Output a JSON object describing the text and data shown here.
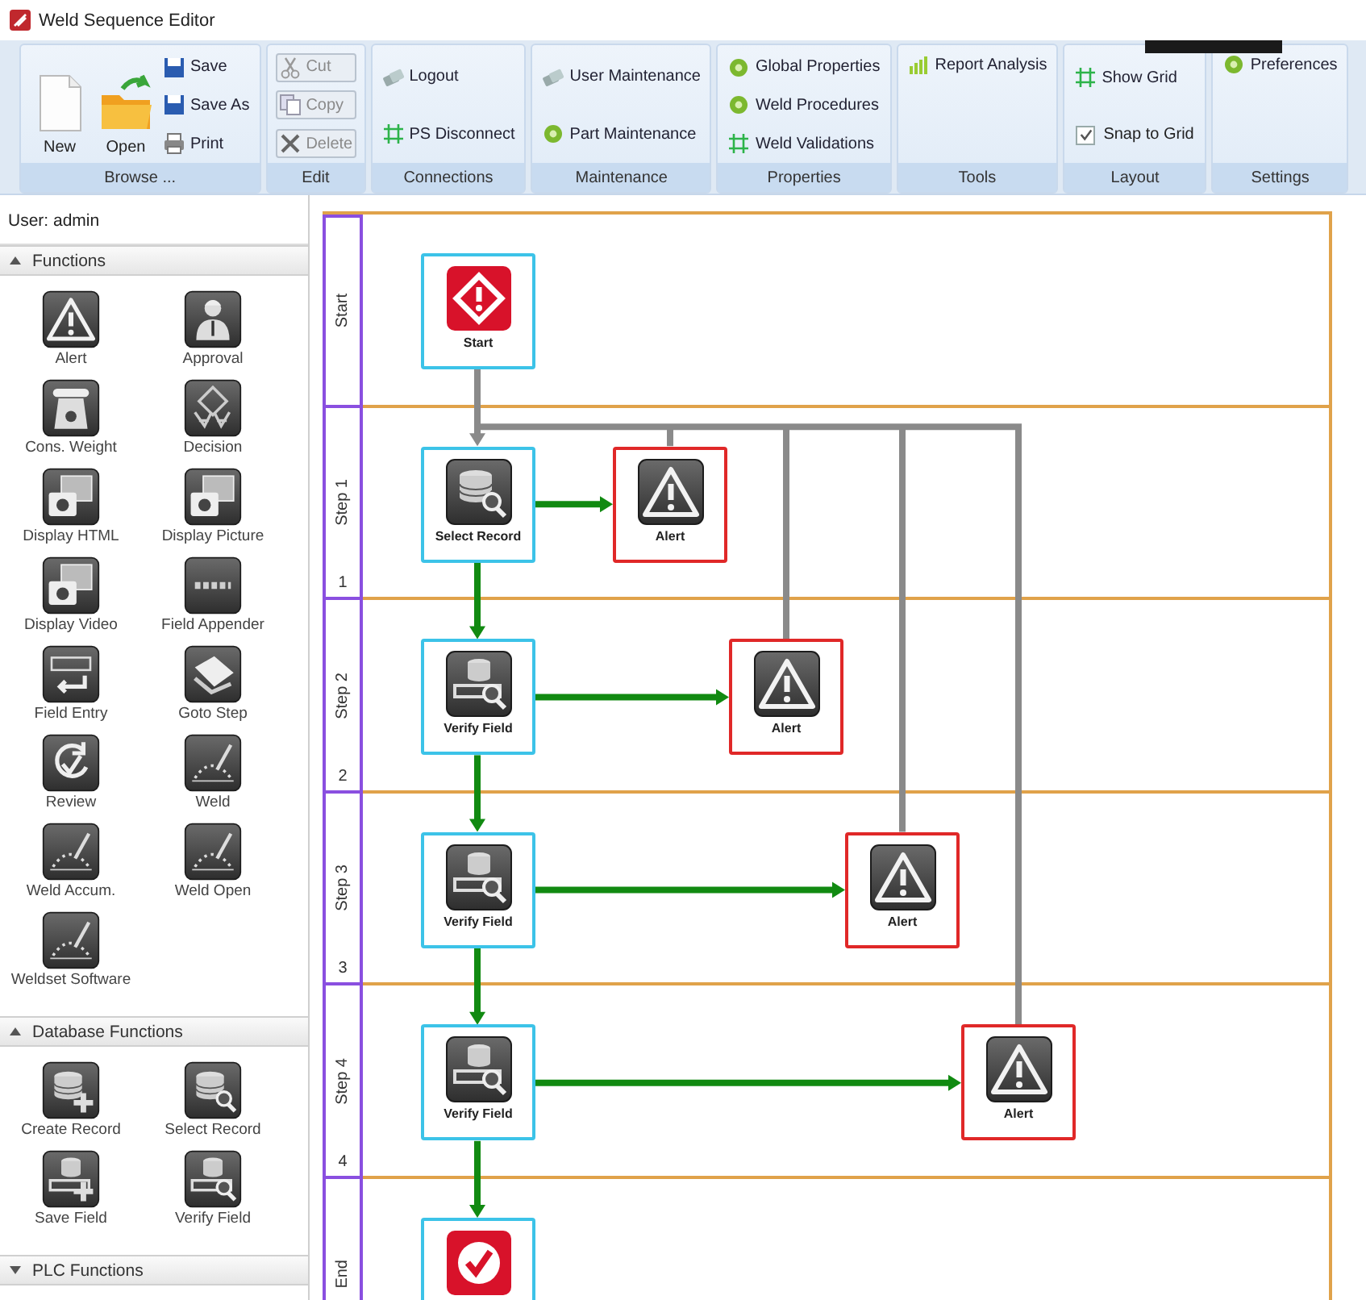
{
  "window": {
    "title": "Weld Sequence Editor"
  },
  "ribbon": {
    "groups": [
      {
        "label": "Browse ...",
        "items": [
          {
            "label": "New",
            "kind": "large",
            "disabled": false
          },
          {
            "label": "Open",
            "kind": "large",
            "disabled": false
          },
          {
            "label": "Save",
            "kind": "small",
            "disabled": false
          },
          {
            "label": "Save As",
            "kind": "small",
            "disabled": false
          },
          {
            "label": "Print",
            "kind": "small",
            "disabled": false
          }
        ]
      },
      {
        "label": "Edit",
        "items": [
          {
            "label": "Cut",
            "kind": "small",
            "disabled": true
          },
          {
            "label": "Copy",
            "kind": "small",
            "disabled": true
          },
          {
            "label": "Delete",
            "kind": "small",
            "disabled": true
          }
        ]
      },
      {
        "label": "Connections",
        "items": [
          {
            "label": "Logout",
            "kind": "small",
            "disabled": false
          },
          {
            "label": "PS Disconnect",
            "kind": "small",
            "disabled": false
          }
        ]
      },
      {
        "label": "Maintenance",
        "items": [
          {
            "label": "User Maintenance",
            "kind": "small",
            "disabled": false
          },
          {
            "label": "Part Maintenance",
            "kind": "small",
            "disabled": false
          }
        ]
      },
      {
        "label": "Properties",
        "items": [
          {
            "label": "Global Properties",
            "kind": "small",
            "disabled": false
          },
          {
            "label": "Weld Procedures",
            "kind": "small",
            "disabled": false
          },
          {
            "label": "Weld Validations",
            "kind": "small",
            "disabled": false
          }
        ]
      },
      {
        "label": "Tools",
        "items": [
          {
            "label": "Report Analysis",
            "kind": "small",
            "disabled": false
          }
        ]
      },
      {
        "label": "Layout",
        "items": [
          {
            "label": "Show Grid",
            "kind": "small",
            "disabled": false
          },
          {
            "label": "Snap to Grid",
            "kind": "checkbox",
            "checked": true,
            "disabled": false
          }
        ]
      },
      {
        "label": "Settings",
        "items": [
          {
            "label": "Preferences",
            "kind": "small",
            "disabled": false
          }
        ]
      }
    ]
  },
  "sidebar": {
    "user": "User: admin",
    "sections": [
      {
        "title": "Functions",
        "expanded": true,
        "items": [
          {
            "label": "Alert",
            "kind": "alert"
          },
          {
            "label": "Approval",
            "kind": "approval"
          },
          {
            "label": "Cons. Weight",
            "kind": "weight"
          },
          {
            "label": "Decision",
            "kind": "decision"
          },
          {
            "label": "Display HTML",
            "kind": "display"
          },
          {
            "label": "Display Picture",
            "kind": "display"
          },
          {
            "label": "Display Video",
            "kind": "display"
          },
          {
            "label": "Field Appender",
            "kind": "appender"
          },
          {
            "label": "Field Entry",
            "kind": "entry"
          },
          {
            "label": "Goto Step",
            "kind": "goto"
          },
          {
            "label": "Review",
            "kind": "review"
          },
          {
            "label": "Weld",
            "kind": "weld"
          },
          {
            "label": "Weld Accum.",
            "kind": "weld"
          },
          {
            "label": "Weld Open",
            "kind": "weld"
          },
          {
            "label": "Weldset Software",
            "kind": "weld"
          }
        ]
      },
      {
        "title": "Database Functions",
        "expanded": true,
        "items": [
          {
            "label": "Create Record",
            "kind": "record-add"
          },
          {
            "label": "Select Record",
            "kind": "record-search"
          },
          {
            "label": "Save Field",
            "kind": "field-add"
          },
          {
            "label": "Verify Field",
            "kind": "field-search"
          }
        ]
      },
      {
        "title": "PLC Functions",
        "expanded": false
      }
    ]
  },
  "diagram": {
    "lanes": [
      {
        "title": "Start",
        "nodes": [
          {
            "kind": "start",
            "label": "Start"
          }
        ]
      },
      {
        "title": "Step 1",
        "number": "1",
        "nodes": [
          {
            "kind": "record-search",
            "label": "Select Record"
          },
          {
            "kind": "alert",
            "label": "Alert"
          }
        ]
      },
      {
        "title": "Step 2",
        "number": "2",
        "nodes": [
          {
            "kind": "field-search",
            "label": "Verify Field"
          },
          {
            "kind": "alert",
            "label": "Alert"
          }
        ]
      },
      {
        "title": "Step 3",
        "number": "3",
        "nodes": [
          {
            "kind": "field-search",
            "label": "Verify Field"
          },
          {
            "kind": "alert",
            "label": "Alert"
          }
        ]
      },
      {
        "title": "Step 4",
        "number": "4",
        "nodes": [
          {
            "kind": "field-search",
            "label": "Verify Field"
          },
          {
            "kind": "alert",
            "label": "Alert"
          }
        ]
      },
      {
        "title": "End",
        "nodes": [
          {
            "kind": "end"
          }
        ]
      }
    ]
  }
}
